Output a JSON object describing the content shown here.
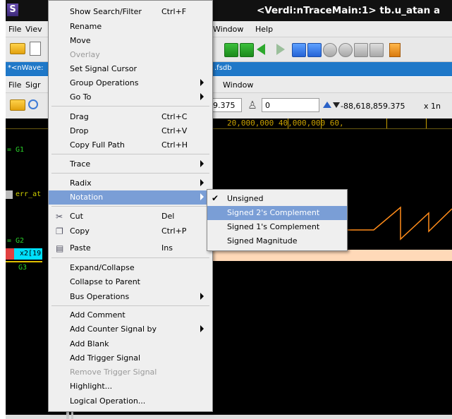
{
  "title_bar": {
    "app_icon": "S",
    "title": "<Verdi:nTraceMain:1> tb.u_atan a"
  },
  "main_menubar": {
    "file": "File",
    "view": "Viev",
    "window": "Window",
    "help": "Help"
  },
  "nwave_tab": {
    "label": "*<nWave:",
    "fsdb": ".fsdb"
  },
  "wave_menubar": {
    "file": "File",
    "signal": "Sigr",
    "window": "Window"
  },
  "wave_toolbar": {
    "time_field": "9.375",
    "value_field": "0",
    "coordinate": "-88,618,859.375",
    "zoom": "x 1n"
  },
  "ruler": "20,000,000      40,000,000      60,",
  "signal_pane": {
    "group1": "= G1",
    "signal1": "err_at",
    "group2": "= G2",
    "signal2": "x2[19",
    "group3": "G3"
  },
  "colors": {
    "title_bg": "#111111",
    "tab_bg": "#1f78c8",
    "menu_highlight": "#7a9ed6",
    "wave_bg": "#000000",
    "wave_line": "#ff8c1a",
    "group_text": "#2bd62b",
    "ruler_text": "#c8a000"
  },
  "context_menu": {
    "items": [
      {
        "label": "Show Search/Filter",
        "shortcut": "Ctrl+F"
      },
      {
        "label": "Rename",
        "shortcut": ""
      },
      {
        "label": "Move",
        "shortcut": ""
      },
      {
        "label": "Overlay",
        "shortcut": ""
      },
      {
        "label": "Set Signal Cursor",
        "shortcut": ""
      },
      {
        "label": "Group Operations",
        "shortcut": ""
      },
      {
        "label": "Go To",
        "shortcut": ""
      },
      {
        "label": "Drag",
        "shortcut": "Ctrl+C"
      },
      {
        "label": "Drop",
        "shortcut": "Ctrl+V"
      },
      {
        "label": "Copy Full Path",
        "shortcut": "Ctrl+H"
      },
      {
        "label": "Trace",
        "shortcut": ""
      },
      {
        "label": "Radix",
        "shortcut": ""
      },
      {
        "label": "Notation",
        "shortcut": ""
      },
      {
        "label": "Cut",
        "shortcut": "Del"
      },
      {
        "label": "Copy",
        "shortcut": "Ctrl+P"
      },
      {
        "label": "Paste",
        "shortcut": "Ins"
      },
      {
        "label": "Expand/Collapse",
        "shortcut": ""
      },
      {
        "label": "Collapse to Parent",
        "shortcut": ""
      },
      {
        "label": "Bus Operations",
        "shortcut": ""
      },
      {
        "label": "Add Comment",
        "shortcut": ""
      },
      {
        "label": "Add Counter Signal by",
        "shortcut": ""
      },
      {
        "label": "Add Blank",
        "shortcut": ""
      },
      {
        "label": "Add Trigger Signal",
        "shortcut": ""
      },
      {
        "label": "Remove Trigger Signal",
        "shortcut": ""
      },
      {
        "label": "Highlight...",
        "shortcut": ""
      },
      {
        "label": "Logical Operation...",
        "shortcut": ""
      }
    ]
  },
  "notation_submenu": {
    "items": [
      "Unsigned",
      "Signed 2's Complement",
      "Signed 1's Complement",
      "Signed Magnitude"
    ]
  }
}
